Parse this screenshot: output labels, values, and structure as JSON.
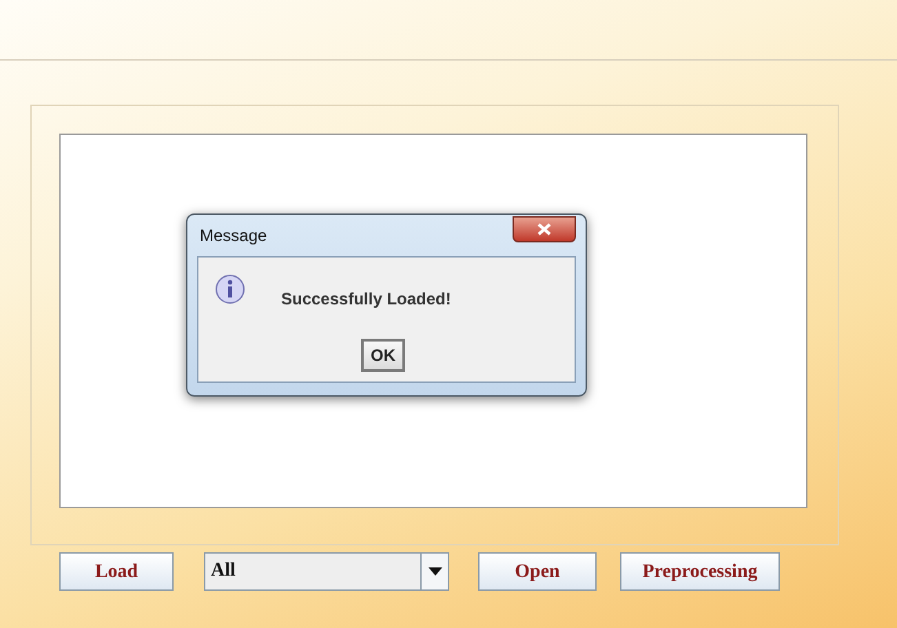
{
  "dialog": {
    "title": "Message",
    "message": "Successfully Loaded!",
    "button": "OK"
  },
  "toolbar": {
    "load_button": "Load",
    "filter_select": {
      "value": "All"
    },
    "open_button": "Open",
    "preprocessing_button": "Preprocessing"
  }
}
